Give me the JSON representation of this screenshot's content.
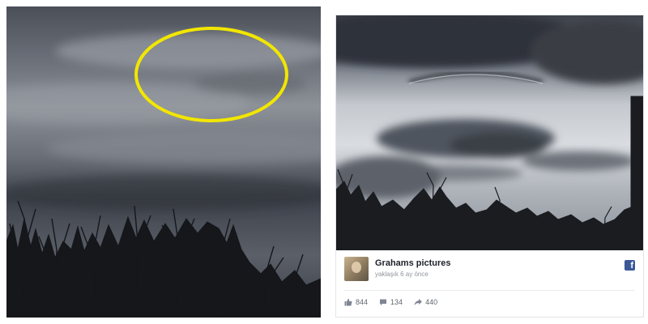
{
  "post": {
    "author": "Grahams pictures",
    "time": "yaklaşık 6 ay önce",
    "network_icon": "facebook-icon",
    "brand_color": "#3b5998"
  },
  "stats": {
    "likes": "844",
    "comments": "134",
    "shares": "440"
  },
  "annotation": {
    "shape": "ellipse",
    "color": "#f2e600"
  }
}
